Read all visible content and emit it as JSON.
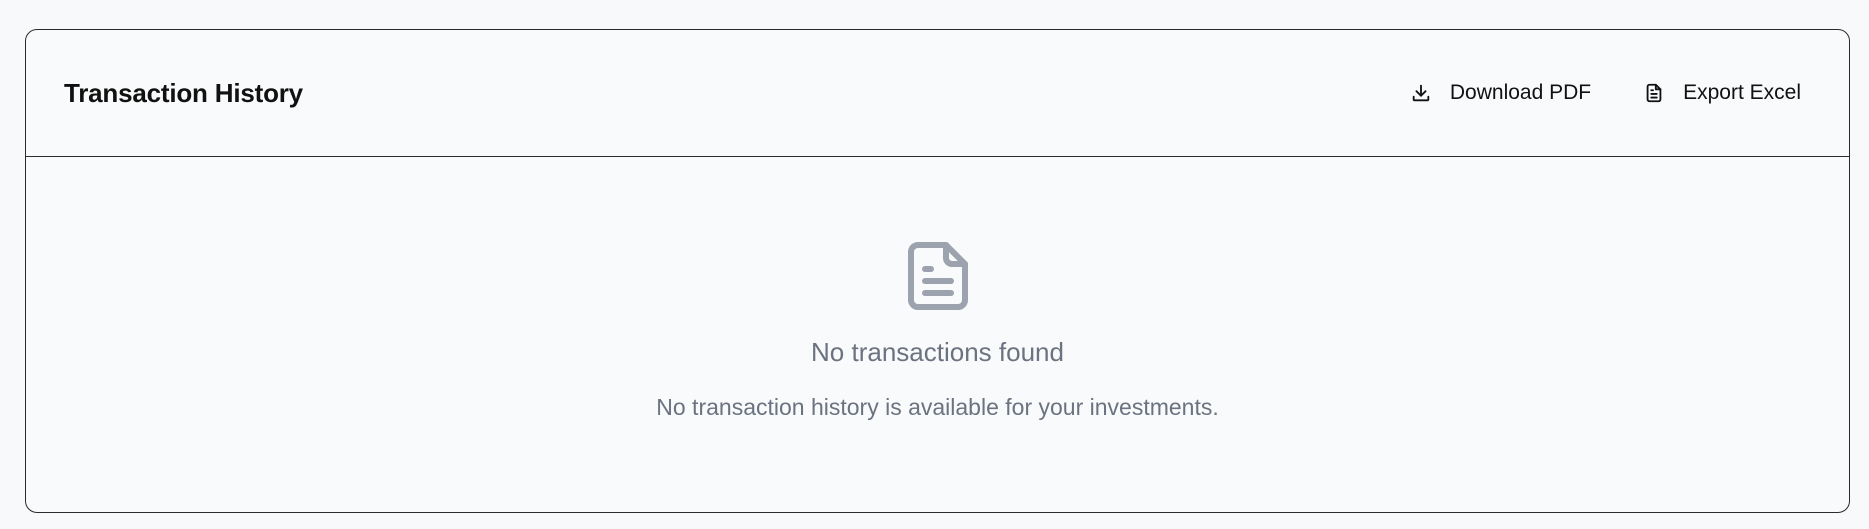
{
  "card": {
    "title": "Transaction History",
    "actions": {
      "download_pdf": {
        "label": "Download PDF",
        "icon": "download-icon"
      },
      "export_excel": {
        "label": "Export Excel",
        "icon": "file-text-icon"
      }
    }
  },
  "empty_state": {
    "icon": "document-icon",
    "title": "No transactions found",
    "description": "No transaction history is available for your investments."
  },
  "colors": {
    "page_background": "#f8f9fb",
    "card_border": "#2b2b2b",
    "muted_text": "#6b7280",
    "empty_icon": "#9ca3af",
    "title_text": "#111111"
  }
}
